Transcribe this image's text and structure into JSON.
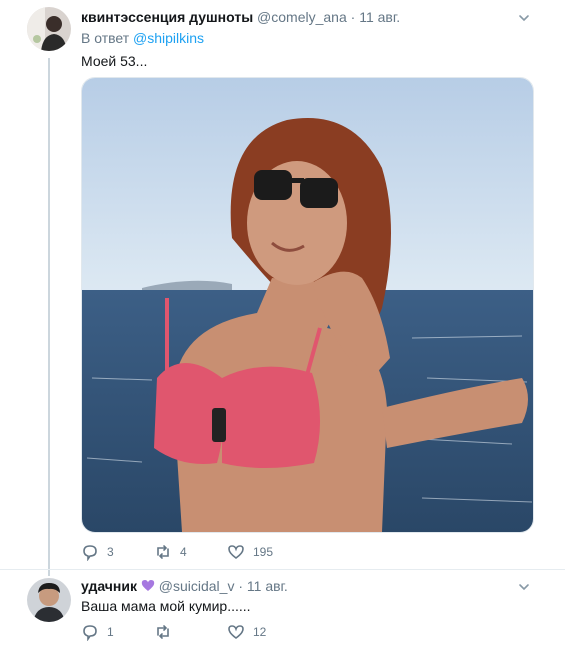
{
  "tweet1": {
    "display_name": "квинтэссенция душноты",
    "handle": "@comely_ana",
    "separator": "·",
    "date": "11 авг.",
    "reply_prefix": "В ответ",
    "reply_to": "@shipilkins",
    "text": "Моей 53...",
    "media_icon": "photo-woman-sea",
    "actions": {
      "replies": "3",
      "retweets": "4",
      "likes": "195"
    }
  },
  "tweet2": {
    "display_name": "удачник",
    "badge_icon": "purple-heart-icon",
    "handle": "@suicidal_v",
    "separator": "·",
    "date": "11 авг.",
    "text": "Ваша мама мой кумир......",
    "actions": {
      "replies": "1",
      "retweets": "",
      "likes": "12"
    }
  },
  "colors": {
    "accent": "#1da1f2",
    "muted": "#657786",
    "thread_line": "#ccd6dd",
    "heart_badge": "#a678e0"
  }
}
